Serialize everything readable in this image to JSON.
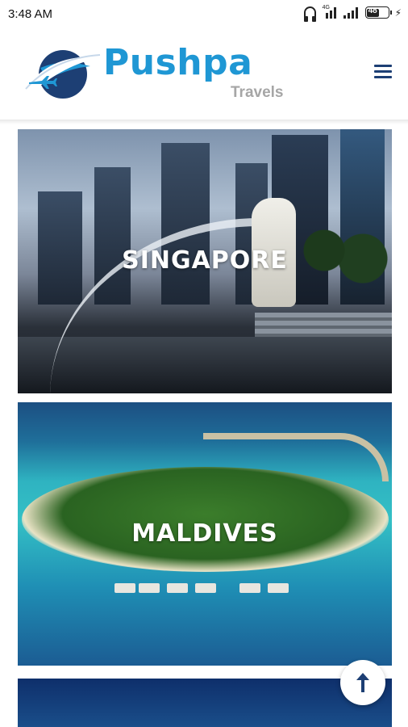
{
  "status_bar": {
    "time": "3:48 AM",
    "network_tag": "4G",
    "battery_level": "48"
  },
  "header": {
    "brand_name": "Pushpa",
    "brand_sub": "Travels",
    "menu_icon": "hamburger-menu-icon"
  },
  "destinations": [
    {
      "label": "SINGAPORE"
    },
    {
      "label": "MALDIVES"
    }
  ],
  "colors": {
    "brand_blue": "#1f97d4",
    "menu_navy": "#1d3f74",
    "sub_gray": "#a6a6a6"
  },
  "back_to_top": {
    "icon": "arrow-up-icon"
  }
}
